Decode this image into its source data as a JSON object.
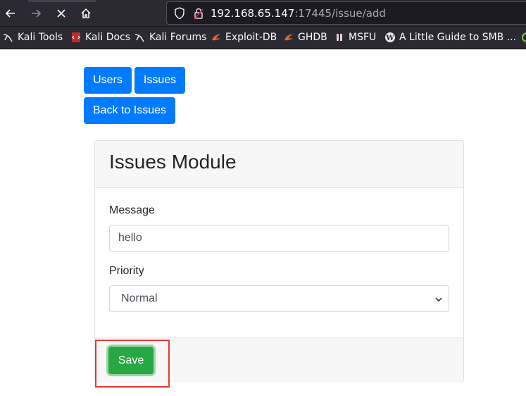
{
  "browser": {
    "url_host": "192.168.65.147",
    "url_path": ":17445/issue/add",
    "bookmarks": [
      {
        "label": "Kali Tools",
        "icon": "kali-dragon-icon"
      },
      {
        "label": "Kali Docs",
        "icon": "kali-docs-icon"
      },
      {
        "label": "Kali Forums",
        "icon": "kali-dragon-icon"
      },
      {
        "label": "Exploit-DB",
        "icon": "exploit-db-icon"
      },
      {
        "label": "GHDB",
        "icon": "exploit-db-icon"
      },
      {
        "label": "MSFU",
        "icon": "msfu-icon"
      },
      {
        "label": "A Little Guide to SMB ...",
        "icon": "wordpress-icon"
      }
    ]
  },
  "nav": {
    "users_label": "Users",
    "issues_label": "Issues",
    "back_label": "Back to Issues"
  },
  "card": {
    "title": "Issues Module",
    "message_label": "Message",
    "message_value": "hello",
    "priority_label": "Priority",
    "priority_value": "Normal",
    "save_label": "Save"
  },
  "colors": {
    "primary": "#007bff",
    "success": "#28a745",
    "highlight": "#e53935",
    "chrome": "#2b2a33"
  }
}
